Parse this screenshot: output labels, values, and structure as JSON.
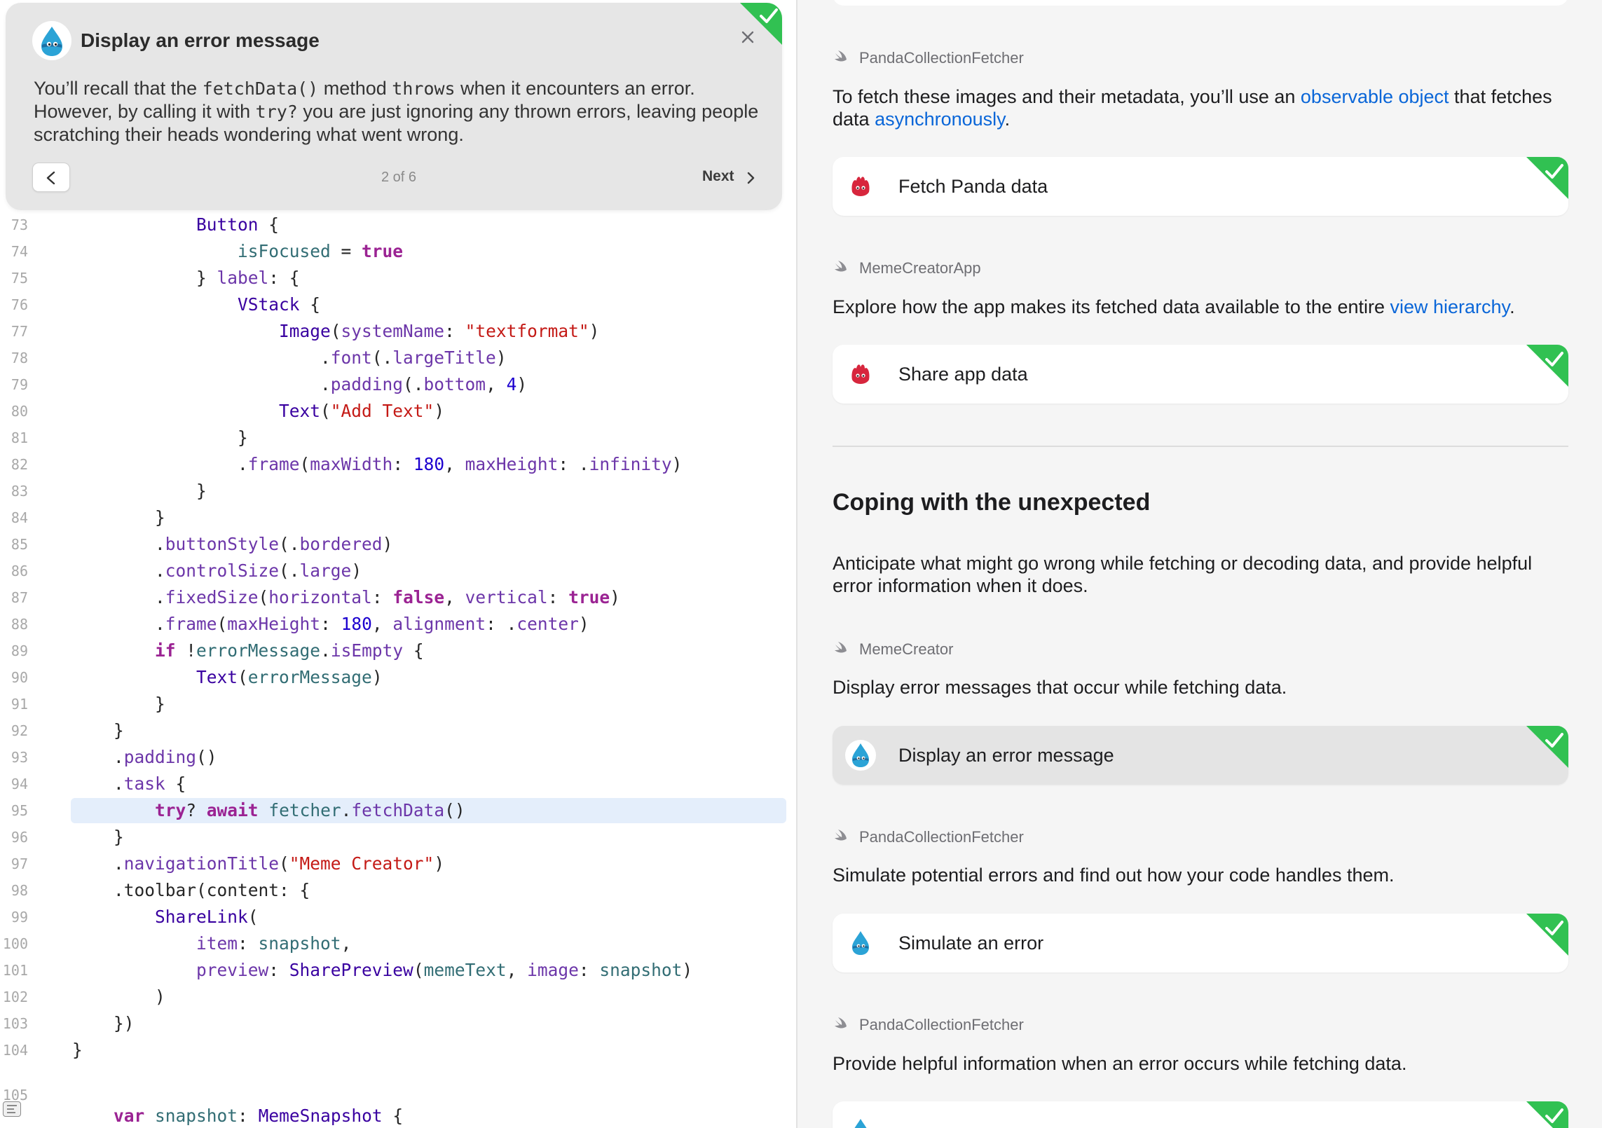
{
  "popover": {
    "title": "Display an error message",
    "body_parts": [
      "You’ll recall that the ",
      "fetchData()",
      " method ",
      "throws",
      " when it encounters an error. However, by calling it with ",
      "try?",
      " you are just ignoring any thrown errors, leaving people scratching their heads wondering what went wrong."
    ],
    "step_counter": "2 of 6",
    "next_label": "Next",
    "icons": {
      "avatar": "swift-drop-icon",
      "close": "close-icon",
      "prev": "chevron-left-icon",
      "next": "chevron-right-icon",
      "completed": "checkmark-icon"
    }
  },
  "editor": {
    "top_clipped_line": "72",
    "bottom_clipped_line": "105",
    "highlighted_line": "95",
    "lines": [
      {
        "n": "73",
        "t": [
          [
            "",
            "            "
          ],
          [
            "type",
            "Button"
          ],
          [
            "",
            " {"
          ]
        ]
      },
      {
        "n": "74",
        "t": [
          [
            "",
            "                "
          ],
          [
            "prop",
            "isFocused"
          ],
          [
            "",
            " = "
          ],
          [
            "kw",
            "true"
          ]
        ]
      },
      {
        "n": "75",
        "t": [
          [
            "",
            "            } "
          ],
          [
            "fn",
            "label"
          ],
          [
            "",
            ": {"
          ]
        ]
      },
      {
        "n": "76",
        "t": [
          [
            "",
            "                "
          ],
          [
            "type",
            "VStack"
          ],
          [
            "",
            " {"
          ]
        ]
      },
      {
        "n": "77",
        "t": [
          [
            "",
            "                    "
          ],
          [
            "type",
            "Image"
          ],
          [
            "",
            "("
          ],
          [
            "fn",
            "systemName"
          ],
          [
            "",
            ": "
          ],
          [
            "str",
            "\"textformat\""
          ],
          [
            "",
            ")"
          ]
        ]
      },
      {
        "n": "78",
        "t": [
          [
            "",
            "                        ."
          ],
          [
            "fn",
            "font"
          ],
          [
            "",
            "(."
          ],
          [
            "fn",
            "largeTitle"
          ],
          [
            "",
            ")"
          ]
        ]
      },
      {
        "n": "79",
        "t": [
          [
            "",
            "                        ."
          ],
          [
            "fn",
            "padding"
          ],
          [
            "",
            "(."
          ],
          [
            "fn",
            "bottom"
          ],
          [
            "",
            ", "
          ],
          [
            "num",
            "4"
          ],
          [
            "",
            ")"
          ]
        ]
      },
      {
        "n": "80",
        "t": [
          [
            "",
            "                    "
          ],
          [
            "type",
            "Text"
          ],
          [
            "",
            "("
          ],
          [
            "str",
            "\"Add Text\""
          ],
          [
            "",
            ")"
          ]
        ]
      },
      {
        "n": "81",
        "t": [
          [
            "",
            "                }"
          ]
        ]
      },
      {
        "n": "82",
        "t": [
          [
            "",
            "                ."
          ],
          [
            "fn",
            "frame"
          ],
          [
            "",
            "("
          ],
          [
            "fn",
            "maxWidth"
          ],
          [
            "",
            ": "
          ],
          [
            "num",
            "180"
          ],
          [
            "",
            ", "
          ],
          [
            "fn",
            "maxHeight"
          ],
          [
            "",
            ": ."
          ],
          [
            "fn",
            "infinity"
          ],
          [
            "",
            ")"
          ]
        ]
      },
      {
        "n": "83",
        "t": [
          [
            "",
            "            }"
          ]
        ]
      },
      {
        "n": "84",
        "t": [
          [
            "",
            "        }"
          ]
        ]
      },
      {
        "n": "85",
        "t": [
          [
            "",
            "        ."
          ],
          [
            "fn",
            "buttonStyle"
          ],
          [
            "",
            "(."
          ],
          [
            "fn",
            "bordered"
          ],
          [
            "",
            ")"
          ]
        ]
      },
      {
        "n": "86",
        "t": [
          [
            "",
            "        ."
          ],
          [
            "fn",
            "controlSize"
          ],
          [
            "",
            "(."
          ],
          [
            "fn",
            "large"
          ],
          [
            "",
            ")"
          ]
        ]
      },
      {
        "n": "87",
        "t": [
          [
            "",
            "        ."
          ],
          [
            "fn",
            "fixedSize"
          ],
          [
            "",
            "("
          ],
          [
            "fn",
            "horizontal"
          ],
          [
            "",
            ": "
          ],
          [
            "kw",
            "false"
          ],
          [
            "",
            ", "
          ],
          [
            "fn",
            "vertical"
          ],
          [
            "",
            ": "
          ],
          [
            "kw",
            "true"
          ],
          [
            "",
            ")"
          ]
        ]
      },
      {
        "n": "88",
        "t": [
          [
            "",
            "        ."
          ],
          [
            "fn",
            "frame"
          ],
          [
            "",
            "("
          ],
          [
            "fn",
            "maxHeight"
          ],
          [
            "",
            ": "
          ],
          [
            "num",
            "180"
          ],
          [
            "",
            ", "
          ],
          [
            "fn",
            "alignment"
          ],
          [
            "",
            ": ."
          ],
          [
            "fn",
            "center"
          ],
          [
            "",
            ")"
          ]
        ]
      },
      {
        "n": "89",
        "t": [
          [
            "",
            "        "
          ],
          [
            "kw",
            "if"
          ],
          [
            "",
            " !"
          ],
          [
            "prop",
            "errorMessage"
          ],
          [
            "",
            "."
          ],
          [
            "fn",
            "isEmpty"
          ],
          [
            "",
            " {"
          ]
        ]
      },
      {
        "n": "90",
        "t": [
          [
            "",
            "            "
          ],
          [
            "type",
            "Text"
          ],
          [
            "",
            "("
          ],
          [
            "prop",
            "errorMessage"
          ],
          [
            "",
            ")"
          ]
        ]
      },
      {
        "n": "91",
        "t": [
          [
            "",
            "        }"
          ]
        ]
      },
      {
        "n": "92",
        "t": [
          [
            "",
            "    }"
          ]
        ]
      },
      {
        "n": "93",
        "t": [
          [
            "",
            "    ."
          ],
          [
            "fn",
            "padding"
          ],
          [
            "",
            "()"
          ]
        ]
      },
      {
        "n": "94",
        "t": [
          [
            "",
            "    ."
          ],
          [
            "fn",
            "task"
          ],
          [
            "",
            " {"
          ]
        ]
      },
      {
        "n": "95",
        "t": [
          [
            "",
            "        "
          ],
          [
            "kw",
            "try"
          ],
          [
            "",
            "? "
          ],
          [
            "kw",
            "await"
          ],
          [
            "",
            " "
          ],
          [
            "prop",
            "fetcher"
          ],
          [
            "",
            "."
          ],
          [
            "fn",
            "fetchData"
          ],
          [
            "",
            "()"
          ]
        ]
      },
      {
        "n": "96",
        "t": [
          [
            "",
            "    }"
          ]
        ]
      },
      {
        "n": "97",
        "t": [
          [
            "",
            "    ."
          ],
          [
            "fn",
            "navigationTitle"
          ],
          [
            "",
            "("
          ],
          [
            "str",
            "\"Meme Creator\""
          ],
          [
            "",
            ")"
          ]
        ]
      },
      {
        "n": "98",
        "t": [
          [
            "",
            "    .toolbar(content: {"
          ]
        ]
      },
      {
        "n": "99",
        "t": [
          [
            "",
            "        "
          ],
          [
            "type",
            "ShareLink"
          ],
          [
            "",
            "("
          ]
        ]
      },
      {
        "n": "100",
        "t": [
          [
            "",
            "            "
          ],
          [
            "fn",
            "item"
          ],
          [
            "",
            ": "
          ],
          [
            "prop",
            "snapshot"
          ],
          [
            "",
            ","
          ]
        ]
      },
      {
        "n": "101",
        "t": [
          [
            "",
            "            "
          ],
          [
            "fn",
            "preview"
          ],
          [
            "",
            ": "
          ],
          [
            "type",
            "SharePreview"
          ],
          [
            "",
            "("
          ],
          [
            "prop",
            "memeText"
          ],
          [
            "",
            ", "
          ],
          [
            "fn",
            "image"
          ],
          [
            "",
            ": "
          ],
          [
            "prop",
            "snapshot"
          ],
          [
            "",
            ")"
          ]
        ]
      },
      {
        "n": "102",
        "t": [
          [
            "",
            "        )"
          ]
        ]
      },
      {
        "n": "103",
        "t": [
          [
            "",
            "    })"
          ]
        ]
      },
      {
        "n": "104",
        "t": [
          [
            "",
            "}"
          ]
        ]
      }
    ],
    "last_line": [
      [
        "kw",
        "var"
      ],
      [
        "",
        " "
      ],
      [
        "prop",
        "snapshot"
      ],
      [
        "",
        ": "
      ],
      [
        "type",
        "MemeSnapshot"
      ],
      [
        "",
        " {"
      ]
    ]
  },
  "tutorial": {
    "blocks": [
      {
        "file": "PandaCollectionFetcher",
        "text_parts": [
          [
            "To fetch these images and their metadata, you’ll use an ",
            false
          ],
          [
            "observable object",
            true
          ],
          [
            " that fetches data ",
            false
          ],
          [
            "asynchronously",
            true
          ],
          [
            ".",
            false
          ]
        ],
        "card": "Fetch Panda data",
        "card_avatar": "red-mascot-icon"
      },
      {
        "file": "MemeCreatorApp",
        "text_parts": [
          [
            "Explore how the app makes its fetched data available to the entire ",
            false
          ],
          [
            "view hierarchy",
            true
          ],
          [
            ".",
            false
          ]
        ],
        "card": "Share app data",
        "card_avatar": "red-mascot-icon"
      }
    ],
    "section_heading": "Coping with the unexpected",
    "section_intro": "Anticipate what might go wrong while fetching or decoding data, and provide helpful error information when it does.",
    "blocks2": [
      {
        "file": "MemeCreator",
        "text": "Display error messages that occur while fetching data.",
        "card": "Display an error message",
        "selected": true
      },
      {
        "file": "PandaCollectionFetcher",
        "text": "Simulate potential errors and find out how your code handles them.",
        "card": "Simulate an error"
      },
      {
        "file": "PandaCollectionFetcher",
        "text": "Provide helpful information when an error occurs while fetching data."
      }
    ],
    "file_icon": "swift-file-icon",
    "completed_color": "#31c152",
    "link_color": "#0a66d8"
  }
}
